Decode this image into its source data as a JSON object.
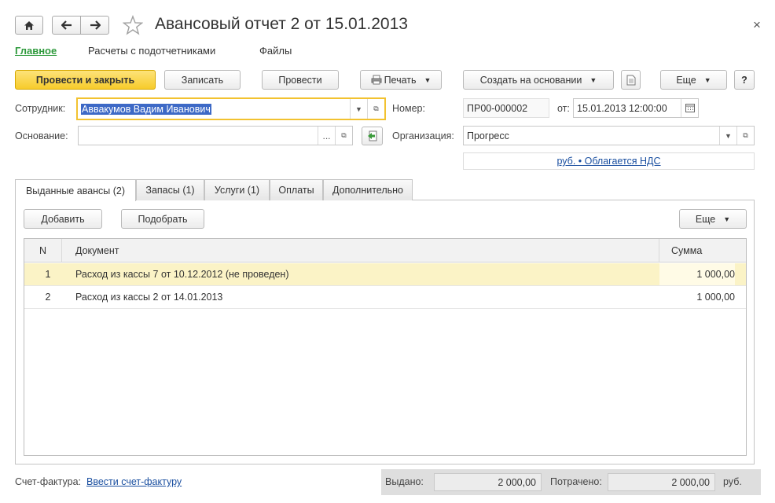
{
  "window": {
    "title": "Авансовый отчет 2 от 15.01.2013",
    "close_glyph": "×"
  },
  "nav_tabs": [
    {
      "label": "Главное",
      "active": true
    },
    {
      "label": "Расчеты с подотчетниками",
      "active": false
    },
    {
      "label": "Файлы",
      "active": false
    }
  ],
  "toolbar": {
    "post_and_close": "Провести и закрыть",
    "save": "Записать",
    "post": "Провести",
    "print": "Печать",
    "create_based_on": "Создать на основании",
    "more": "Еще",
    "help": "?"
  },
  "form": {
    "employee_label": "Сотрудник:",
    "employee_value": "Аввакумов Вадим Иванович",
    "number_label": "Номер:",
    "number_value": "ПР00-000002",
    "date_label": "от:",
    "date_value": "15.01.2013 12:00:00",
    "basis_label": "Основание:",
    "basis_value": "",
    "basis_select": "...",
    "org_label": "Организация:",
    "org_value": "Прогресс",
    "currency_link": "руб. • Облагается НДС"
  },
  "tabs": [
    {
      "label": "Выданные авансы (2)",
      "active": true
    },
    {
      "label": "Запасы (1)",
      "active": false
    },
    {
      "label": "Услуги (1)",
      "active": false
    },
    {
      "label": "Оплаты",
      "active": false
    },
    {
      "label": "Дополнительно",
      "active": false
    }
  ],
  "table_toolbar": {
    "add": "Добавить",
    "pick": "Подобрать",
    "more": "Еще"
  },
  "table": {
    "columns": [
      "N",
      "Документ",
      "Сумма"
    ],
    "rows": [
      {
        "n": "1",
        "doc": "Расход из кассы 7 от 10.12.2012 (не проведен)",
        "sum": "1 000,00",
        "selected": true
      },
      {
        "n": "2",
        "doc": "Расход из кассы 2 от 14.01.2013",
        "sum": "1 000,00",
        "selected": false
      }
    ]
  },
  "footer": {
    "invoice_label": "Счет-фактура:",
    "invoice_link": "Ввести счет-фактуру",
    "issued_label": "Выдано:",
    "issued_value": "2 000,00",
    "spent_label": "Потрачено:",
    "spent_value": "2 000,00",
    "currency": "руб."
  },
  "colors": {
    "accent_green": "#2e9a3c",
    "primary_button": "#f7cc2b",
    "selected_row": "#fbf3c6",
    "focus_border": "#f2c230",
    "link": "#1a4fa0"
  }
}
